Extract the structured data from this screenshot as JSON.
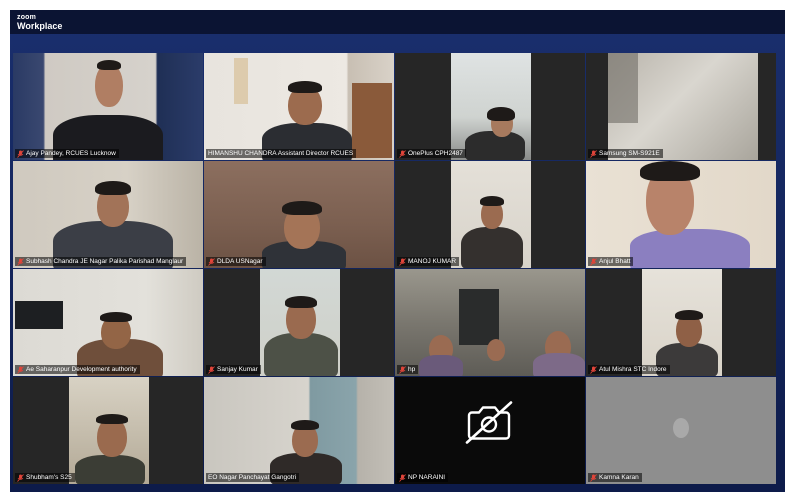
{
  "app": {
    "brand_top": "zoom",
    "brand_bottom": "Workplace"
  },
  "participants": [
    {
      "name": "Ajay Pandey, RCUES Lucknow"
    },
    {
      "name": "HIMANSHU CHANDRA Assistant Director RCUES"
    },
    {
      "name": "OnePlus CPH2487"
    },
    {
      "name": "Samsung SM-S921E"
    },
    {
      "name": "Subhash Chandra JE Nagar Palika Parishad Manglaur"
    },
    {
      "name": "DLDA USNagar"
    },
    {
      "name": "MANOJ KUMAR"
    },
    {
      "name": "Anjul Bhatt"
    },
    {
      "name": "Ae Saharanpur Development authority"
    },
    {
      "name": "Sanjay Kumar"
    },
    {
      "name": "hp"
    },
    {
      "name": "Atul Mishra STC Indore"
    },
    {
      "name": "Shubham's S25"
    },
    {
      "name": "EO Nagar Panchayat Gangotri"
    },
    {
      "name": "NP NARAINI"
    },
    {
      "name": "Kamna Karan"
    }
  ],
  "colors": {
    "active_speaker_border": "#3ad29f",
    "muted_mic": "#e0453a"
  }
}
